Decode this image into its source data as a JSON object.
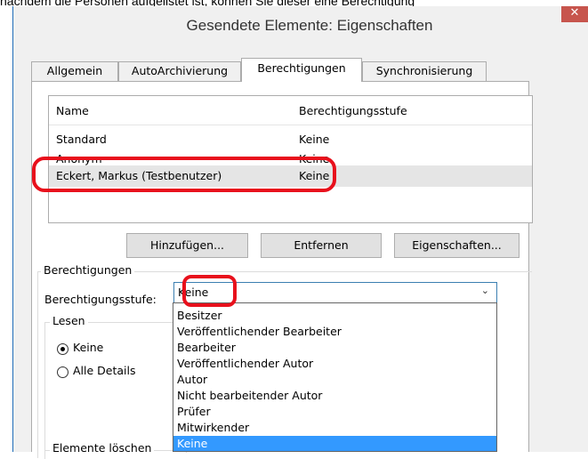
{
  "caption": "nachdem die Personen aufgelistet ist, können Sie dieser eine Berechtigung",
  "window": {
    "title": "Gesendete Elemente: Eigenschaften",
    "close_glyph": "✕"
  },
  "tabs": [
    {
      "label": "Allgemein",
      "active": false
    },
    {
      "label": "AutoArchivierung",
      "active": false
    },
    {
      "label": "Berechtigungen",
      "active": true
    },
    {
      "label": "Synchronisierung",
      "active": false
    }
  ],
  "permissions_list": {
    "columns": [
      "Name",
      "Berechtigungsstufe"
    ],
    "rows": [
      {
        "name": "Standard",
        "level": "Keine"
      },
      {
        "name": "Anonym",
        "level": "Keine"
      },
      {
        "name": "Eckert, Markus (Testbenutzer)",
        "level": "Keine",
        "selected": true
      }
    ]
  },
  "buttons": {
    "add": "Hinzufügen...",
    "remove": "Entfernen",
    "properties": "Eigenschaften..."
  },
  "permissions_group": {
    "title": "Berechtigungen",
    "level_label": "Berechtigungsstufe:",
    "level_value": "Keine",
    "level_options": [
      "Besitzer",
      "Veröffentlichender Bearbeiter",
      "Bearbeiter",
      "Veröffentlichender Autor",
      "Autor",
      "Nicht bearbeitender Autor",
      "Prüfer",
      "Mitwirkender",
      "Keine"
    ],
    "selected_option": "Keine"
  },
  "read_group": {
    "title": "Lesen",
    "options": [
      {
        "label": "Keine",
        "checked": true
      },
      {
        "label": "Alle Details",
        "checked": false
      }
    ]
  },
  "delete_group": {
    "title": "Elemente löschen"
  },
  "colors": {
    "highlight": "#e8101c",
    "selection": "#3399ff",
    "close": "#c7554d"
  }
}
